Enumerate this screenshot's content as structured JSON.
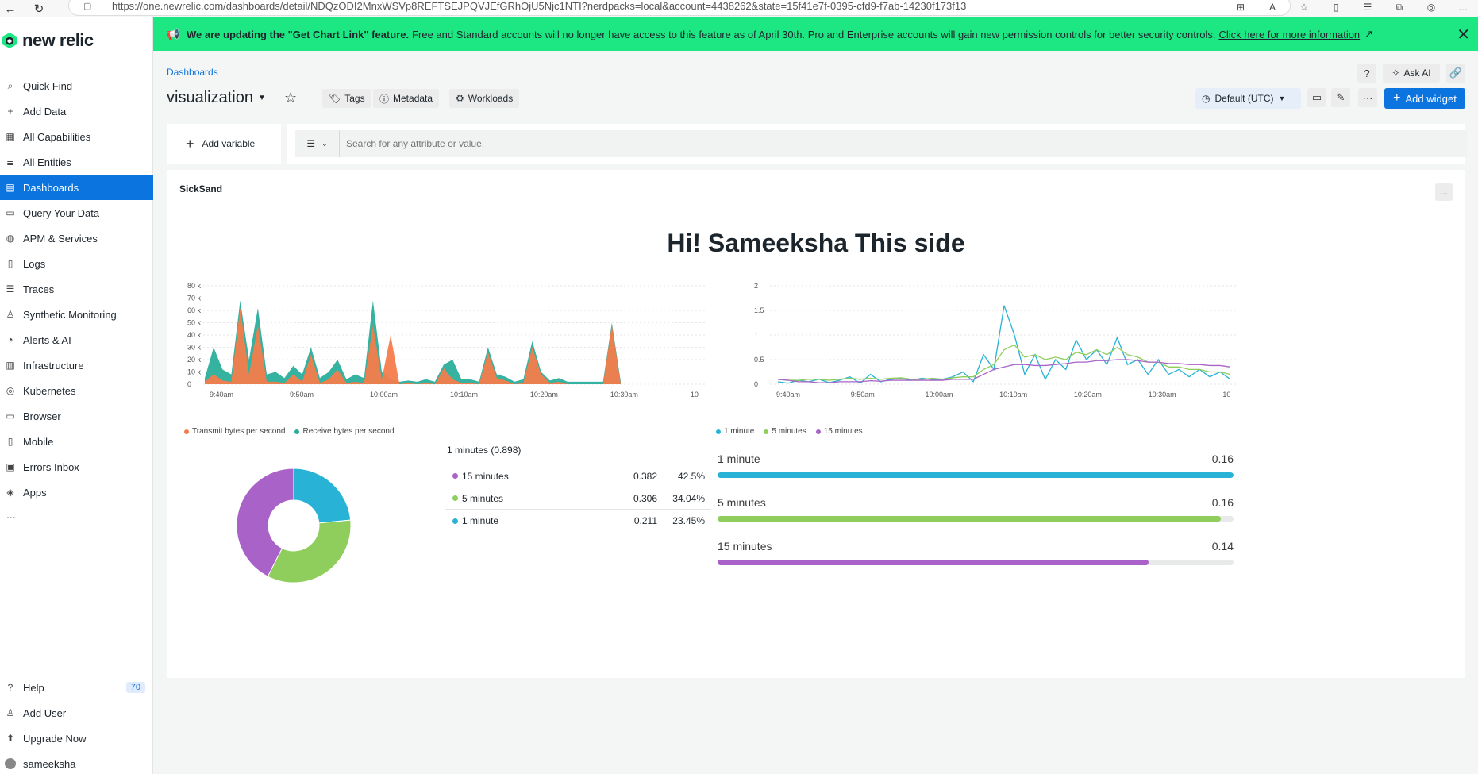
{
  "browser": {
    "url": "https://one.newrelic.com/dashboards/detail/NDQzODI2MnxWSVp8REFTSEJPQVJEfGRhOjU5Njc1NTI?nerdpacks=local&account=4438262&state=15f41e7f-0395-cfd9-f7ab-14230f173f13"
  },
  "sidebar": {
    "logo_text": "new relic",
    "items": [
      {
        "label": "Quick Find",
        "icon": "search-icon"
      },
      {
        "label": "Add Data",
        "icon": "plus-icon"
      },
      {
        "label": "All Capabilities",
        "icon": "grid-icon"
      },
      {
        "label": "All Entities",
        "icon": "stack-icon"
      },
      {
        "label": "Dashboards",
        "icon": "dashboard-icon",
        "active": true
      },
      {
        "label": "Query Your Data",
        "icon": "terminal-icon"
      },
      {
        "label": "APM & Services",
        "icon": "globe-icon"
      },
      {
        "label": "Logs",
        "icon": "document-icon"
      },
      {
        "label": "Traces",
        "icon": "traces-icon"
      },
      {
        "label": "Synthetic Monitoring",
        "icon": "synthetic-icon"
      },
      {
        "label": "Alerts & AI",
        "icon": "alert-icon"
      },
      {
        "label": "Infrastructure",
        "icon": "infrastructure-icon"
      },
      {
        "label": "Kubernetes",
        "icon": "kubernetes-icon"
      },
      {
        "label": "Browser",
        "icon": "browser-icon"
      },
      {
        "label": "Mobile",
        "icon": "mobile-icon"
      },
      {
        "label": "Errors Inbox",
        "icon": "inbox-icon"
      },
      {
        "label": "Apps",
        "icon": "apps-icon"
      }
    ],
    "more": "...",
    "bottom": {
      "help": "Help",
      "help_badge": "70",
      "add_user": "Add User",
      "upgrade": "Upgrade Now",
      "user": "sameeksha"
    }
  },
  "banner": {
    "bold_text": "We are updating the \"Get Chart Link\" feature.",
    "text": "Free and Standard accounts will no longer have access to this feature as of April 30th. Pro and Enterprise accounts will gain new permission controls for better security controls.",
    "link": "Click here for more information",
    "bg_color": "#1ce783"
  },
  "header": {
    "breadcrumb": "Dashboards",
    "title": "visualization",
    "tags_label": "Tags",
    "metadata_label": "Metadata",
    "workloads_label": "Workloads",
    "ask_ai_label": "Ask AI",
    "time_label": "Default (UTC)",
    "add_widget_label": "Add widget"
  },
  "filters": {
    "add_variable_label": "Add variable",
    "search_placeholder": "Search for any attribute or value."
  },
  "widget": {
    "title": "SickSand",
    "headline": "Hi! Sameeksha This side",
    "menu": "..."
  },
  "chart_data": [
    {
      "type": "area",
      "title": "",
      "x_ticks": [
        "9:40am",
        "9:50am",
        "10:00am",
        "10:10am",
        "10:20am",
        "10:30am",
        "10"
      ],
      "y_ticks": [
        "80 k",
        "70 k",
        "60 k",
        "50 k",
        "40 k",
        "30 k",
        "20 k",
        "10 k",
        "0"
      ],
      "ylim": [
        0,
        80000
      ],
      "series": [
        {
          "name": "Receive bytes per second",
          "color": "#2aae9b",
          "values": [
            5000,
            30000,
            12000,
            8000,
            68000,
            20000,
            62000,
            8000,
            10000,
            5000,
            15000,
            8000,
            30000,
            5000,
            10000,
            20000,
            4000,
            8000,
            5000,
            68000,
            10000,
            4000,
            2000,
            3000,
            2000,
            4000,
            2000,
            16000,
            20000,
            4000,
            4000,
            2000,
            30000,
            8000,
            6000,
            2000,
            4000,
            35000,
            10000,
            3000,
            5000,
            2000,
            2000,
            2000,
            2000,
            2000,
            50000,
            2000
          ]
        },
        {
          "name": "Transmit bytes per second",
          "color": "#f47c4c",
          "values": [
            2000,
            8000,
            3000,
            2000,
            62000,
            8000,
            48000,
            2000,
            2000,
            1000,
            8000,
            2000,
            24000,
            1000,
            4000,
            12000,
            1000,
            2000,
            1000,
            48000,
            4000,
            40000,
            0,
            1000,
            0,
            1000,
            0,
            13000,
            4000,
            1000,
            1000,
            0,
            26000,
            5000,
            3000,
            0,
            1000,
            30000,
            8000,
            1000,
            2000,
            0,
            0,
            0,
            0,
            0,
            48000,
            0
          ]
        }
      ]
    },
    {
      "type": "line",
      "title": "",
      "x_ticks": [
        "9:40am",
        "9:50am",
        "10:00am",
        "10:10am",
        "10:20am",
        "10:30am",
        "10"
      ],
      "y_ticks": [
        "2",
        "1.5",
        "1",
        "0.5",
        "0"
      ],
      "ylim": [
        0,
        2
      ],
      "series": [
        {
          "name": "1 minute",
          "color": "#28b3d6",
          "values": [
            0.05,
            0.02,
            0.08,
            0.05,
            0.1,
            0.03,
            0.08,
            0.15,
            0.02,
            0.2,
            0.05,
            0.1,
            0.12,
            0.08,
            0.12,
            0.1,
            0.1,
            0.15,
            0.25,
            0.05,
            0.6,
            0.3,
            1.6,
            1.0,
            0.2,
            0.6,
            0.1,
            0.5,
            0.3,
            0.9,
            0.5,
            0.7,
            0.4,
            0.95,
            0.4,
            0.5,
            0.2,
            0.5,
            0.2,
            0.3,
            0.15,
            0.3,
            0.15,
            0.25,
            0.1
          ]
        },
        {
          "name": "5 minutes",
          "color": "#8fcd5c",
          "values": [
            0.1,
            0.08,
            0.08,
            0.1,
            0.1,
            0.08,
            0.1,
            0.12,
            0.1,
            0.12,
            0.1,
            0.12,
            0.13,
            0.1,
            0.1,
            0.12,
            0.1,
            0.13,
            0.15,
            0.15,
            0.3,
            0.4,
            0.7,
            0.8,
            0.55,
            0.6,
            0.5,
            0.55,
            0.5,
            0.65,
            0.6,
            0.7,
            0.6,
            0.75,
            0.6,
            0.55,
            0.45,
            0.45,
            0.35,
            0.35,
            0.3,
            0.3,
            0.25,
            0.25,
            0.2
          ]
        },
        {
          "name": "15 minutes",
          "color": "#a962c7",
          "values": [
            0.1,
            0.08,
            0.05,
            0.05,
            0.03,
            0.03,
            0.05,
            0.05,
            0.05,
            0.07,
            0.06,
            0.08,
            0.08,
            0.08,
            0.08,
            0.08,
            0.08,
            0.1,
            0.1,
            0.1,
            0.2,
            0.3,
            0.35,
            0.4,
            0.4,
            0.38,
            0.38,
            0.4,
            0.42,
            0.45,
            0.45,
            0.48,
            0.48,
            0.5,
            0.5,
            0.48,
            0.45,
            0.45,
            0.42,
            0.42,
            0.4,
            0.4,
            0.38,
            0.38,
            0.35
          ]
        }
      ]
    },
    {
      "type": "pie",
      "title": "1 minutes (0.898)",
      "slices": [
        {
          "name": "15 minutes",
          "value": 0.382,
          "percent": "42.5%",
          "color": "#a962c7"
        },
        {
          "name": "5 minutes",
          "value": 0.306,
          "percent": "34.04%",
          "color": "#8fcd5c"
        },
        {
          "name": "1 minute",
          "value": 0.211,
          "percent": "23.45%",
          "color": "#28b3d6"
        }
      ]
    },
    {
      "type": "bar",
      "title": "",
      "categories": [
        "1 minute",
        "5 minutes",
        "15 minutes"
      ],
      "values": [
        0.16,
        0.16,
        0.14
      ],
      "fill_fraction": [
        1.0,
        0.976,
        0.836
      ],
      "colors": [
        "#28b3d6",
        "#8fcd5c",
        "#a962c7"
      ]
    }
  ]
}
